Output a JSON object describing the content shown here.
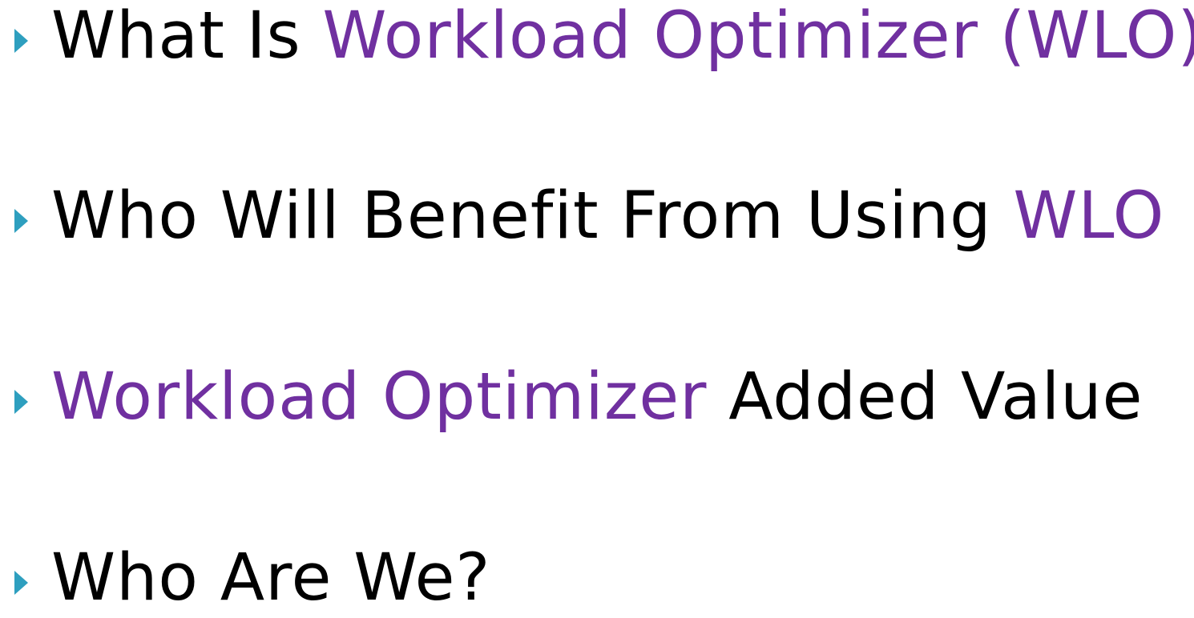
{
  "colors": {
    "bullet": "#2E9FBF",
    "text": "#000000",
    "accent": "#7030A0"
  },
  "bullets": [
    {
      "icon": "triangle-bullet-icon",
      "parts": [
        {
          "text": "What Is ",
          "accent": false
        },
        {
          "text": "Workload Optimizer (WLO)",
          "accent": true
        }
      ]
    },
    {
      "icon": "triangle-bullet-icon",
      "parts": [
        {
          "text": "Who Will Benefit From Using ",
          "accent": false
        },
        {
          "text": "WLO",
          "accent": true
        }
      ]
    },
    {
      "icon": "triangle-bullet-icon",
      "parts": [
        {
          "text": "Workload Optimizer",
          "accent": true
        },
        {
          "text": " Added Value",
          "accent": false
        }
      ]
    },
    {
      "icon": "triangle-bullet-icon",
      "parts": [
        {
          "text": "Who Are We?",
          "accent": false
        }
      ]
    }
  ]
}
